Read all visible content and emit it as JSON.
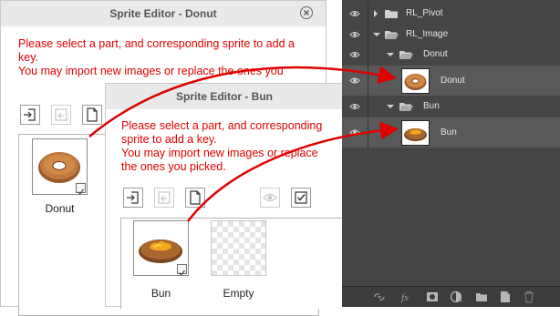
{
  "donut_dialog": {
    "title": "Sprite Editor - Donut",
    "description": "Please select a part, and corresponding sprite to add a key.\nYou may import new images or replace the ones you picked.",
    "thumbs": [
      {
        "label": "Donut"
      }
    ]
  },
  "bun_dialog": {
    "title": "Sprite Editor - Bun",
    "description": "Please select a part, and corresponding sprite to add a key.\nYou may import new images or replace the ones you picked.",
    "thumbs": [
      {
        "label": "Bun"
      },
      {
        "label": "Empty"
      }
    ]
  },
  "layers_panel": {
    "rows": [
      {
        "label": "RL_Pivot",
        "type": "group",
        "expanded": false
      },
      {
        "label": "RL_Image",
        "type": "group",
        "expanded": true
      },
      {
        "label": "Donut",
        "type": "group",
        "expanded": true
      },
      {
        "label": "Donut",
        "type": "layer"
      },
      {
        "label": "Bun",
        "type": "group",
        "expanded": true
      },
      {
        "label": "Bun",
        "type": "layer"
      }
    ],
    "bottom_icons": [
      "link-icon",
      "fx-icon",
      "mask-icon",
      "adjustment-icon",
      "group-folder-icon",
      "new-layer-icon",
      "trash-icon"
    ]
  },
  "colors": {
    "annotation": "#e00000",
    "ps_panel": "#454545",
    "ps_selected": "#595959"
  }
}
